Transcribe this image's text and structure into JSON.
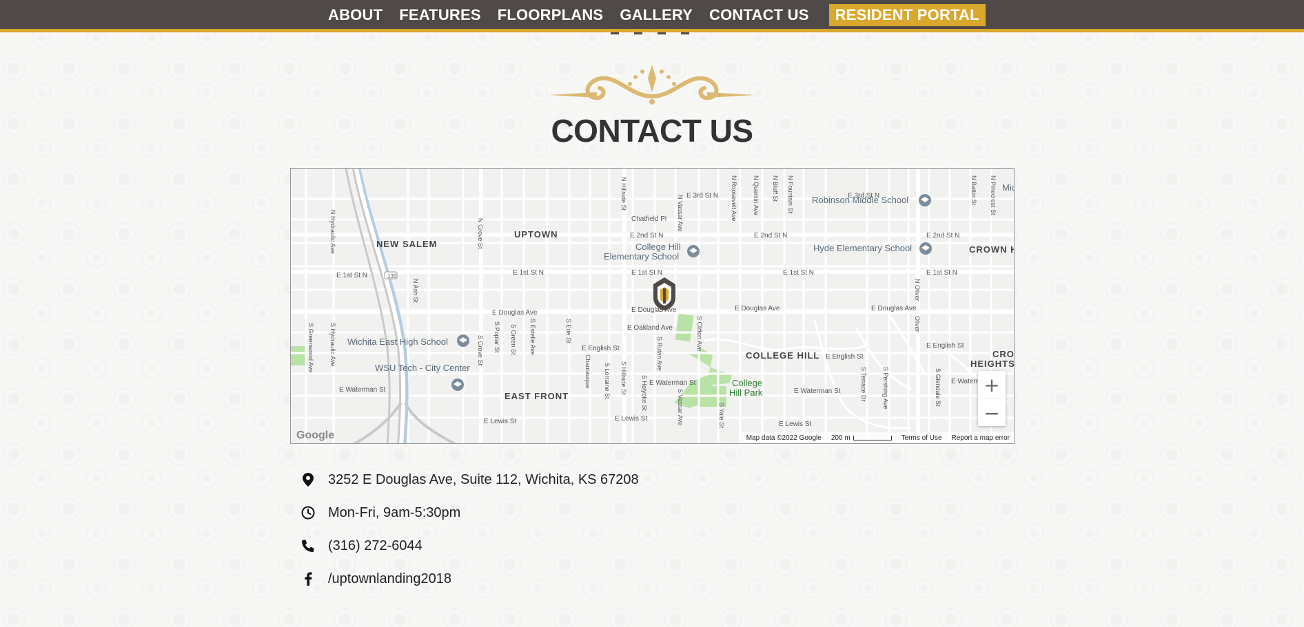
{
  "nav": {
    "items": [
      "ABOUT",
      "FEATURES",
      "FLOORPLANS",
      "GALLERY",
      "CONTACT US"
    ],
    "portal": "RESIDENT PORTAL"
  },
  "page": {
    "title": "CONTACT US"
  },
  "colors": {
    "nav_bg": "#4f4a47",
    "accent": "#d9a82d",
    "ornament": "#dcb972",
    "title": "#333333"
  },
  "map": {
    "neighborhoods": [
      "NEW SALEM",
      "UPTOWN",
      "COLLEGE HILL",
      "EAST FRONT",
      "CROWN H",
      "CRO",
      "HEIGHTS"
    ],
    "pois": [
      "Robinson Middle School",
      "College Hill",
      "Elementary School",
      "Hyde Elementary School",
      "Wichita East High School",
      "WSU Tech - City Center",
      "College",
      "Hill Park",
      "Mic"
    ],
    "streets": {
      "e_3rd": "E 3rd St N",
      "e_2nd": "E 2nd St N",
      "e_1st": "E 1st St N",
      "e_douglas": "E Douglas Ave",
      "e_english": "E English St",
      "e_waterman": "E Waterman St",
      "e_lewis": "E Lewis St",
      "chatfield": "Chatfield Pl",
      "oakland": "E Oakland Ave",
      "n_hydraulic": "N Hydraulic Ave",
      "s_hydraulic": "S Hydraulic Ave",
      "n_grove": "N Grove St",
      "s_grove": "S Grove St",
      "n_hillside": "N Hillside St",
      "s_hillside": "S Hillside St",
      "n_oliver": "N Oliver",
      "oliver": "Oliver",
      "e_waterman_st": "E Waterman St",
      "s_yale": "S Yale St",
      "s_clifton": "S Clifton Ave",
      "s_rutan": "S Rutan Ave",
      "s_holyoke": "S Holyoke St",
      "s_vassar": "S Vassar Ave",
      "s_erie": "S Erie St",
      "s_estelle": "S Estelle Ave",
      "s_green": "S Green St",
      "s_poplar": "S Poplar St",
      "s_greenwood": "S Greenwood Ave",
      "s_lorraine": "S Lorraine St",
      "n_ash": "N Ash St",
      "s_terrace": "S Terrace Dr",
      "s_pershing": "S Pershing Ave",
      "s_glendale": "S Glendale St",
      "n_vassar": "N Vassar Ave",
      "n_roosevelt": "N Roosevelt Ave",
      "n_quentin": "N Quentin Ave",
      "n_bluff": "N Bluff St",
      "n_fountain": "N Fountain St",
      "n_battin": "N Battin St",
      "n_pinecrest": "N Pinecrest St",
      "chautauqua": "Chautauqua",
      "e_english_2": "E English St",
      "e_waterman_2": "E Waterman"
    },
    "highway_shield": "135",
    "zoom_in": "+",
    "zoom_out": "−",
    "attribution": "Map data ©2022 Google",
    "scale_label": "200 m",
    "terms": "Terms of Use",
    "report": "Report a map error",
    "logo": "Google"
  },
  "contact": {
    "address": "3252 E Douglas Ave, Suite 112, Wichita, KS 67208",
    "hours": "Mon-Fri, 9am-5:30pm",
    "phone": "(316) 272-6044",
    "facebook": "/uptownlanding2018"
  },
  "icons": {
    "address": "map-pin-icon",
    "hours": "clock-icon",
    "phone": "phone-icon",
    "facebook": "facebook-icon"
  }
}
